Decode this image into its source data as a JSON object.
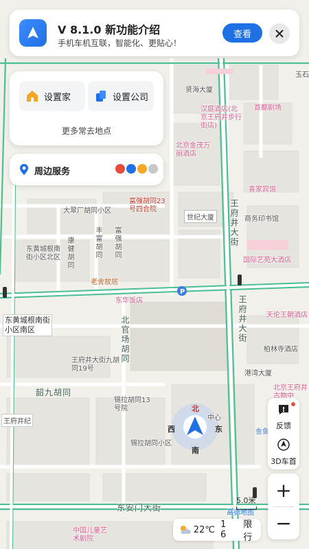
{
  "banner": {
    "title": "V 8.1.0 新功能介绍",
    "subtitle": "手机车机互联，智能化、更贴心！",
    "view_button": "查看"
  },
  "quick": {
    "home": "设置家",
    "company": "设置公司",
    "more": "更多常去地点"
  },
  "nearby": {
    "label": "周边服务"
  },
  "right_panel": {
    "feedback": "反馈",
    "view_mode": "3D车首",
    "zoom_in": "+",
    "zoom_out": "−"
  },
  "status": {
    "weather": "22℃",
    "restriction_numbers": "1 6",
    "restriction_label": "限行"
  },
  "scale": "5.0米",
  "compass": {
    "north": "北",
    "south": "南",
    "east": "东",
    "west": "西"
  },
  "map_labels": {
    "yuhuan": "贤海大厦",
    "qingmen": "玉石",
    "hanting": "汉庭酒店(北京王府井步行街店)",
    "shoudu": "首都剧场",
    "fuhuajia": "北京金茂万丽酒店",
    "xiangtang": "喜家宾馆",
    "dacui": "大翠厂胡同小区",
    "fuqiang": "富强胡同23号四合院",
    "shiji": "世纪大厦",
    "shangwu": "商务印书馆",
    "wangfujing_st": "王府井大街",
    "dongchang": "东黄城根南街小区北区",
    "kangjian": "康健胡同",
    "fugao": "丰富胡同",
    "fuzhong": "富强胡同",
    "guoji": "国际艺苑大酒店",
    "laoshe": "老舍故居",
    "donghua": "东华饭店",
    "tianlun": "天伦王朝酒店",
    "dongcheng_south": "东黄城根南街小区南区",
    "beiguan": "北官场胡同",
    "wangfujing_st2": "王府井大街",
    "xiangbai": "柏林寺酒店",
    "wangfu19": "王府井大街九胡同19号",
    "gangwan": "港湾大厦",
    "shaojiu": "韶九胡同",
    "xila13": "锡拉胡同13号院",
    "bjwangfujing": "北京王府井古物中",
    "wangfujing_ji": "王府井纪",
    "xila_comm": "锡拉胡同小区",
    "jinyu": "金鱼",
    "dongan": "东安门大街",
    "gaode": "高德地图",
    "children": "中国儿童艺术剧院",
    "center": "中心"
  }
}
